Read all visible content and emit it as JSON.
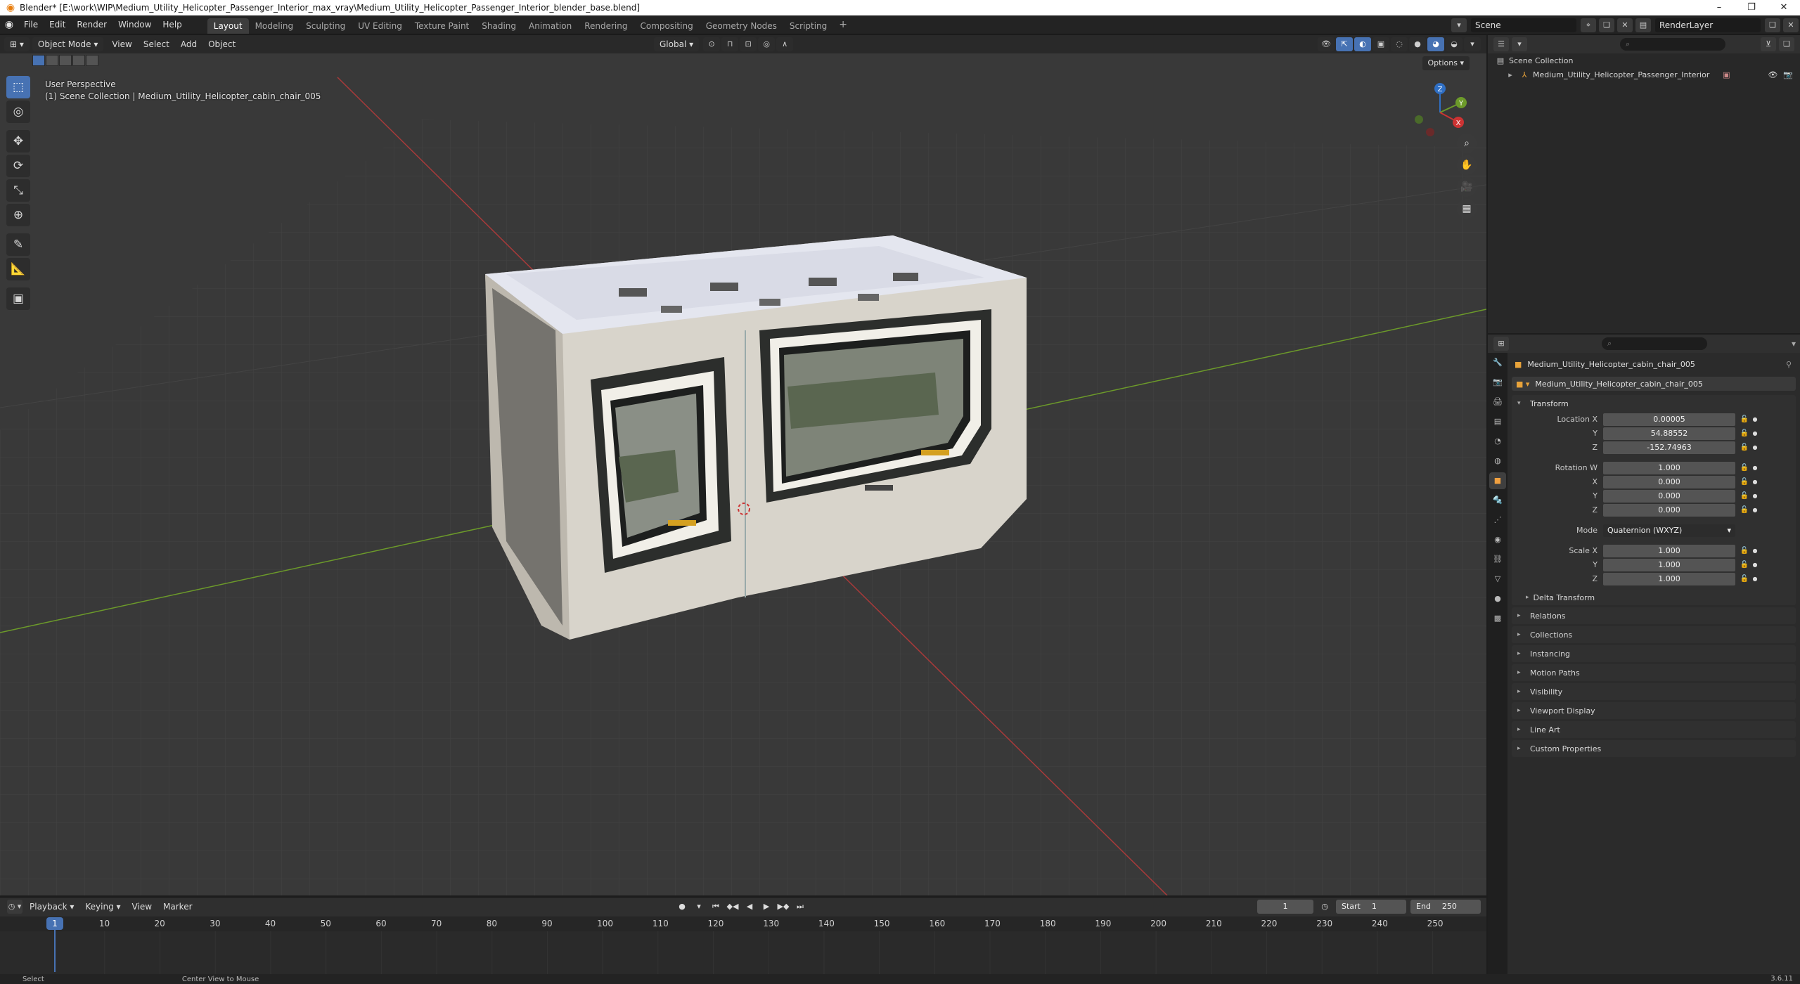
{
  "window": {
    "title": "Blender* [E:\\work\\WIP\\Medium_Utility_Helicopter_Passenger_Interior_max_vray\\Medium_Utility_Helicopter_Passenger_Interior_blender_base.blend]",
    "minimize": "–",
    "maximize": "❐",
    "close": "✕"
  },
  "menu": {
    "items": [
      "File",
      "Edit",
      "Render",
      "Window",
      "Help"
    ]
  },
  "workspaces": [
    {
      "label": "Layout",
      "active": true
    },
    {
      "label": "Modeling"
    },
    {
      "label": "Sculpting"
    },
    {
      "label": "UV Editing"
    },
    {
      "label": "Texture Paint"
    },
    {
      "label": "Shading"
    },
    {
      "label": "Animation"
    },
    {
      "label": "Rendering"
    },
    {
      "label": "Compositing"
    },
    {
      "label": "Geometry Nodes"
    },
    {
      "label": "Scripting"
    }
  ],
  "scene": {
    "name": "Scene",
    "render_layer": "RenderLayer"
  },
  "viewport": {
    "mode": "Object Mode",
    "menus": [
      "View",
      "Select",
      "Add",
      "Object"
    ],
    "transform_orientation": "Global",
    "options_label": "Options",
    "perspective_label": "User Perspective",
    "collection_label": "(1) Scene Collection | Medium_Utility_Helicopter_cabin_chair_005",
    "gizmo_axes": {
      "x": "X",
      "y": "Y",
      "z": "Z"
    }
  },
  "outliner": {
    "root": "Scene Collection",
    "items": [
      "Medium_Utility_Helicopter_Passenger_Interior"
    ]
  },
  "properties": {
    "object_name": "Medium_Utility_Helicopter_cabin_chair_005",
    "object_field": "Medium_Utility_Helicopter_cabin_chair_005",
    "transform_title": "Transform",
    "location": {
      "label": "Location X",
      "x": "0.00005",
      "y": "54.88552",
      "z": "-152.74963"
    },
    "rotation": {
      "label": "Rotation W",
      "w": "1.000",
      "x": "0.000",
      "y": "0.000",
      "z": "0.000"
    },
    "mode": {
      "label": "Mode",
      "value": "Quaternion (WXYZ)"
    },
    "scale": {
      "label": "Scale X",
      "x": "1.000",
      "y": "1.000",
      "z": "1.000"
    },
    "axis_labels": {
      "y": "Y",
      "z": "Z",
      "x": "X"
    },
    "delta_transform": "Delta Transform",
    "panels": [
      "Relations",
      "Collections",
      "Instancing",
      "Motion Paths",
      "Visibility",
      "Viewport Display",
      "Line Art",
      "Custom Properties"
    ]
  },
  "timeline": {
    "menus": [
      "Playback",
      "Keying",
      "View",
      "Marker"
    ],
    "current_frame": "1",
    "start_label": "Start",
    "start": "1",
    "end_label": "End",
    "end": "250",
    "ticks": [
      "10",
      "20",
      "30",
      "40",
      "50",
      "60",
      "70",
      "80",
      "90",
      "100",
      "110",
      "120",
      "130",
      "140",
      "150",
      "160",
      "170",
      "180",
      "190",
      "200",
      "210",
      "220",
      "230",
      "240",
      "250"
    ],
    "marker": "1"
  },
  "status": {
    "select": "Select",
    "center": "Center View to Mouse",
    "version": "3.6.11"
  },
  "colors": {
    "accent": "#4772b3",
    "axis_x": "#a83a3a",
    "axis_y": "#6c9a2a",
    "orange": "#e8a33a"
  }
}
